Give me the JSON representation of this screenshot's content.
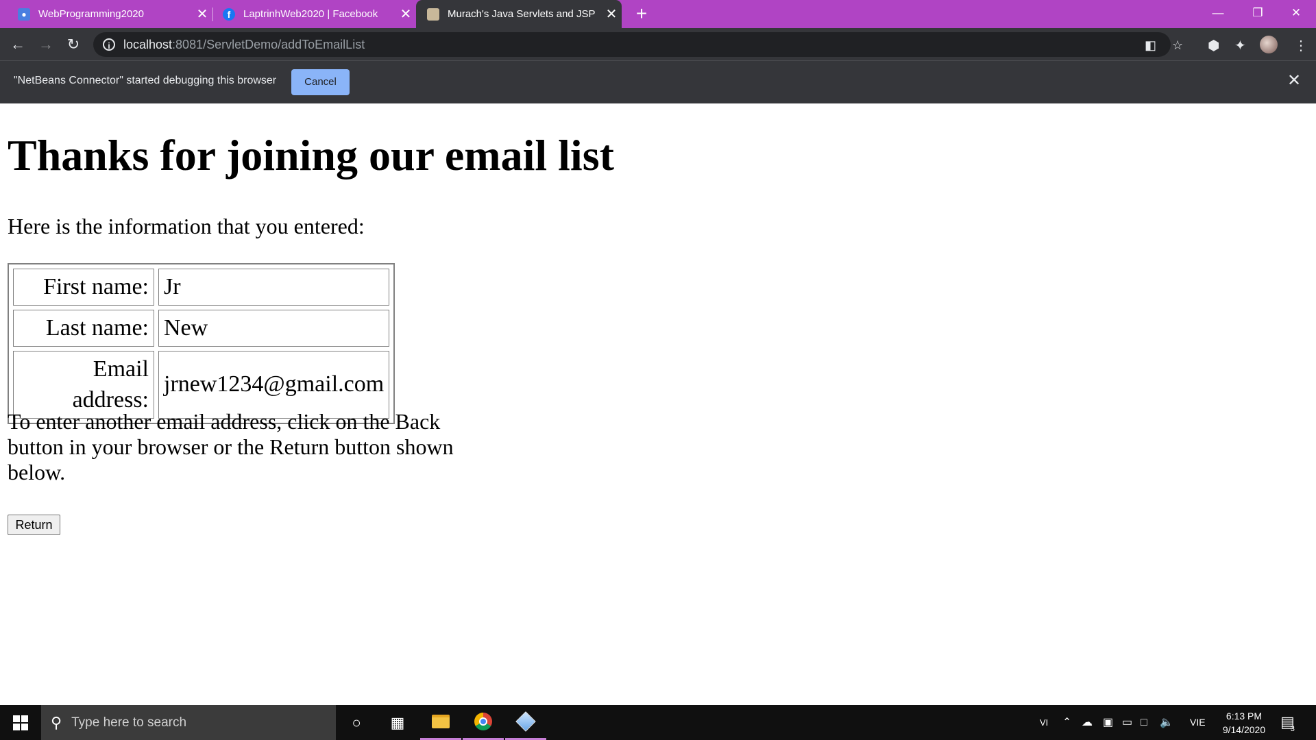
{
  "browser": {
    "tabs": [
      {
        "title": "WebProgramming2020",
        "icon": "classroom-icon",
        "active": false
      },
      {
        "title": "LaptrinhWeb2020 | Facebook",
        "icon": "facebook-icon",
        "active": false
      },
      {
        "title": "Murach's Java Servlets and JSP",
        "icon": "book-icon",
        "active": true
      }
    ],
    "url_host": "localhost",
    "url_rest": ":8081/ServletDemo/addToEmailList",
    "infobar_message": "\"NetBeans Connector\" started debugging this browser",
    "infobar_cancel": "Cancel"
  },
  "page": {
    "heading": "Thanks for joining our email list",
    "intro": "Here is the information that you entered:",
    "fields": [
      {
        "label": "First name:",
        "value": "Jr"
      },
      {
        "label": "Last name:",
        "value": "New"
      },
      {
        "label": "Email address:",
        "value": "jrnew1234@gmail.com"
      }
    ],
    "instructions": "To enter another email address, click on the Back button in your browser or the Return button shown below.",
    "return_label": "Return"
  },
  "taskbar": {
    "search_placeholder": "Type here to search",
    "lang_short": "VI",
    "lang": "VIE",
    "time": "6:13 PM",
    "date": "9/14/2020",
    "notification_count": "3"
  }
}
